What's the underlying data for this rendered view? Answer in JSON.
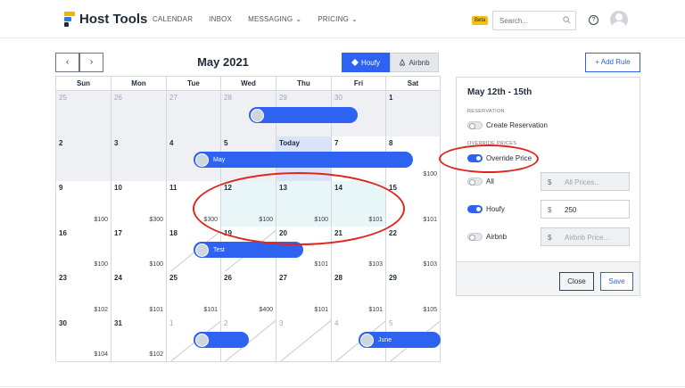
{
  "brand": {
    "name": "Host Tools"
  },
  "nav": {
    "items": [
      {
        "label": "CALENDAR",
        "caret": false
      },
      {
        "label": "INBOX",
        "caret": false
      },
      {
        "label": "MESSAGING",
        "caret": true
      },
      {
        "label": "PRICING",
        "caret": true
      }
    ]
  },
  "header": {
    "beta": "Beta",
    "search_placeholder": "Search...",
    "help": "?"
  },
  "calendar": {
    "prev": "‹",
    "next": "›",
    "month": "May 2021",
    "tabs": {
      "houfy": "Houfy",
      "airbnb": "Airbnb"
    },
    "weekdays": [
      "Sun",
      "Mon",
      "Tue",
      "Wed",
      "Thu",
      "Fri",
      "Sat"
    ],
    "weeks": [
      [
        {
          "day": "25",
          "dim": true,
          "past": true
        },
        {
          "day": "26",
          "dim": true,
          "past": true
        },
        {
          "day": "27",
          "dim": true,
          "past": true
        },
        {
          "day": "28",
          "dim": true,
          "past": true
        },
        {
          "day": "29",
          "dim": true,
          "past": true
        },
        {
          "day": "30",
          "dim": true,
          "past": true
        },
        {
          "day": "1",
          "past": true
        }
      ],
      [
        {
          "day": "2",
          "past": true
        },
        {
          "day": "3",
          "past": true
        },
        {
          "day": "4",
          "past": true
        },
        {
          "day": "5",
          "past": true
        },
        {
          "day": "Today",
          "today": true
        },
        {
          "day": "7"
        },
        {
          "day": "8",
          "price": "$100"
        }
      ],
      [
        {
          "day": "9",
          "price": "$100"
        },
        {
          "day": "10",
          "price": "$300"
        },
        {
          "day": "11",
          "price": "$300"
        },
        {
          "day": "12",
          "price": "$100",
          "sel": true
        },
        {
          "day": "13",
          "price": "$100",
          "sel": true
        },
        {
          "day": "14",
          "price": "$101",
          "sel": true
        },
        {
          "day": "15",
          "price": "$101"
        }
      ],
      [
        {
          "day": "16",
          "price": "$100"
        },
        {
          "day": "17",
          "price": "$100"
        },
        {
          "day": "18",
          "blocked": true
        },
        {
          "day": "19",
          "blocked": true
        },
        {
          "day": "20",
          "price": "$101"
        },
        {
          "day": "21",
          "price": "$103"
        },
        {
          "day": "22",
          "price": "$103"
        }
      ],
      [
        {
          "day": "23",
          "price": "$102"
        },
        {
          "day": "24",
          "price": "$101"
        },
        {
          "day": "25",
          "price": "$101"
        },
        {
          "day": "26",
          "price": "$400"
        },
        {
          "day": "27",
          "price": "$101"
        },
        {
          "day": "28",
          "price": "$101"
        },
        {
          "day": "29",
          "price": "$105"
        }
      ],
      [
        {
          "day": "30",
          "price": "$104"
        },
        {
          "day": "31",
          "price": "$102"
        },
        {
          "day": "1",
          "dim": true,
          "blocked": true
        },
        {
          "day": "2",
          "dim": true,
          "blocked": true
        },
        {
          "day": "3",
          "dim": true,
          "blocked": true
        },
        {
          "day": "4",
          "dim": true,
          "blocked": true
        },
        {
          "day": "5",
          "dim": true,
          "blocked": true
        }
      ]
    ],
    "reservations": [
      {
        "guest": ""
      },
      {
        "guest": "May"
      },
      {
        "guest": "Test"
      },
      {
        "guest": ""
      },
      {
        "guest": "June"
      }
    ]
  },
  "panel": {
    "add_rule": "+ Add Rule",
    "title": "May 12th - 15th",
    "reservation_section": "RESERVATION",
    "create_reservation": "Create Reservation",
    "override_section": "OVERRIDE PRICES",
    "override_price": "Override Price",
    "rows": [
      {
        "label": "All",
        "currency": "$",
        "value": "All Prices...",
        "on": false
      },
      {
        "label": "Houfy",
        "currency": "$",
        "value": "250",
        "on": true
      },
      {
        "label": "Airbnb",
        "currency": "$",
        "value": "Airbnb Price...",
        "on": false
      }
    ],
    "close": "Close",
    "save": "Save"
  },
  "colors": {
    "accent": "#2d63f0",
    "highlight": "#e0261c",
    "beta": "#f4c20d"
  }
}
